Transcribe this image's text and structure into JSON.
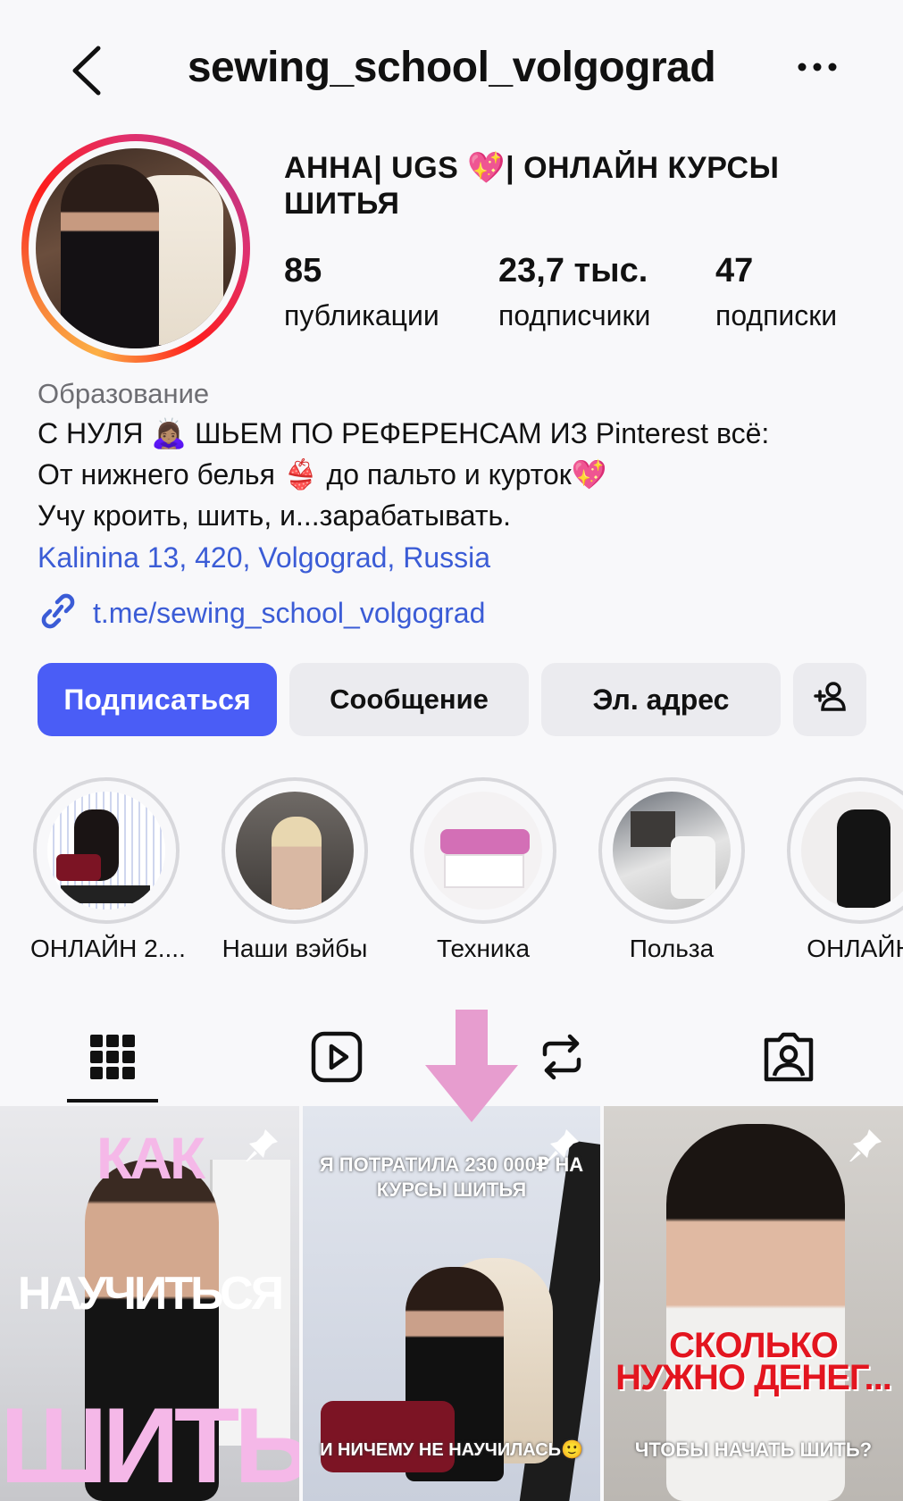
{
  "header": {
    "username": "sewing_school_volgograd"
  },
  "profile": {
    "name": "АННА|  UGS 💖| ОНЛАЙН КУРСЫ ШИТЬЯ",
    "stats": [
      {
        "value": "85",
        "label": "публикации"
      },
      {
        "value": "23,7 тыс.",
        "label": "подписчики"
      },
      {
        "value": "47",
        "label": "подписки"
      }
    ],
    "category": "Образование",
    "bio_lines": [
      "С НУЛЯ 🙇🏽‍♀️ ШЬЕМ ПО РЕФЕРЕНСАМ ИЗ Pinterest всё:",
      "От нижнего белья 👙 до пальто и курток💖",
      "Учу кроить, шить, и...зарабатывать."
    ],
    "location": "Kalinina 13, 420, Volgograd, Russia",
    "link": "t.me/sewing_school_volgograd"
  },
  "actions": {
    "follow": "Подписаться",
    "message": "Сообщение",
    "email": "Эл. адрес"
  },
  "highlights": [
    {
      "label": "ОНЛАЙН 2...."
    },
    {
      "label": "Наши вэйбы"
    },
    {
      "label": "Техника"
    },
    {
      "label": "Польза"
    },
    {
      "label": "ОНЛАЙН"
    }
  ],
  "posts": [
    {
      "lines": [
        "КАК",
        "НАУЧИТЬСЯ",
        "ШИТЬ"
      ]
    },
    {
      "top": "Я ПОТРАТИЛА 230 000₽ НА КУРСЫ ШИТЬЯ",
      "bottom": "И НИЧЕМУ НЕ НАУЧИЛАСЬ🙂"
    },
    {
      "red": "СКОЛЬКО НУЖНО ДЕНЕГ...",
      "white": "ЧТОБЫ НАЧАТЬ ШИТЬ?"
    }
  ],
  "colors": {
    "accent": "#4a5df6",
    "link": "#3b5cd6",
    "arrow": "#e79dcf"
  }
}
